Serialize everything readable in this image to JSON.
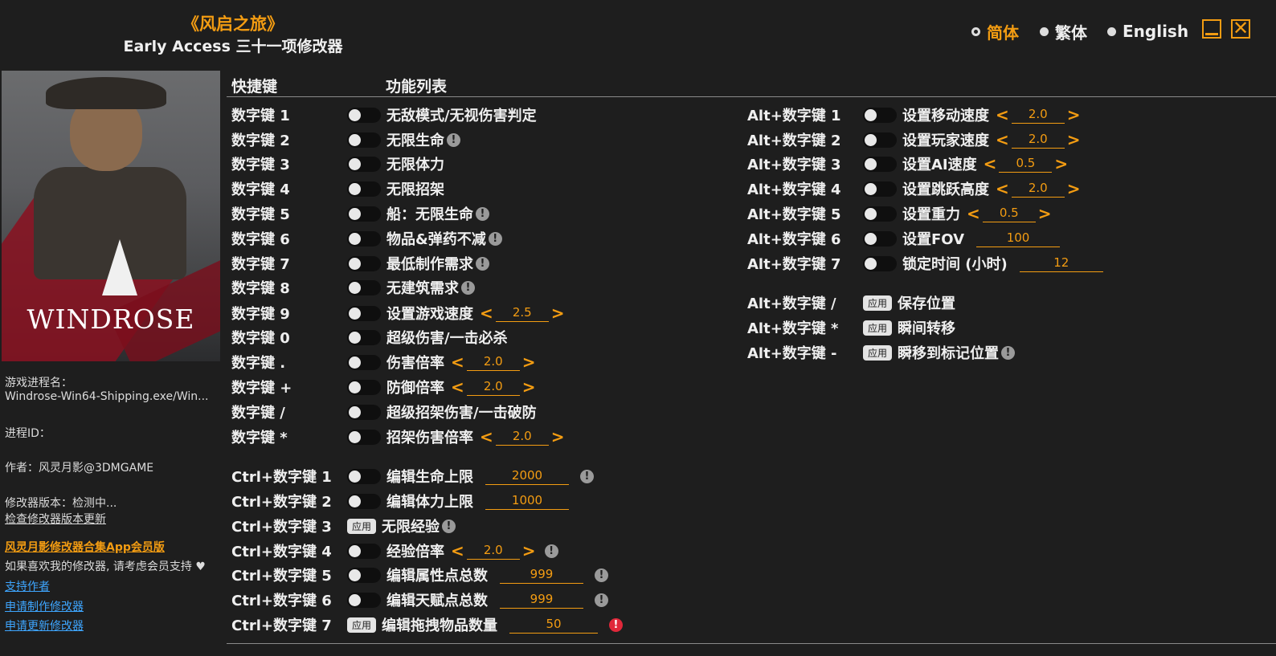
{
  "header": {
    "game_title": "《风启之旅》",
    "subtitle": "Early Access 三十一项修改器",
    "languages": [
      {
        "label": "简体",
        "selected": true
      },
      {
        "label": "繁体",
        "selected": false
      },
      {
        "label": "English",
        "selected": false
      }
    ],
    "minimize_icon": "minimize-icon",
    "close_icon": "close-icon",
    "close_glyph": "✕"
  },
  "colors": {
    "accent": "#f39c12",
    "link": "#3ea6ff",
    "warning": "#e0283a",
    "background": "#1e1e1e"
  },
  "sidebar": {
    "cover_logo": "WINDROSE",
    "process_name_label": "游戏进程名：",
    "process_name_value": "Windrose-Win64-Shipping.exe/Win...",
    "process_id_label": "进程ID：",
    "author": "作者：风灵月影@3DMGAME",
    "version": "修改器版本：检测中...",
    "check_update": "检查修改器版本更新",
    "app_member": "风灵月影修改器合集App会员版",
    "support_note": "如果喜欢我的修改器, 请考虑会员支持 ♥",
    "support_author": "支持作者",
    "request_make": "申请制作修改器",
    "request_update": "申请更新修改器"
  },
  "main": {
    "col_hotkey": "快捷键",
    "col_functions": "功能列表",
    "left_rows": [
      {
        "key": "数字键 1",
        "control": "toggle",
        "name": "无敌模式/无视伤害判定"
      },
      {
        "key": "数字键 2",
        "control": "toggle",
        "name": "无限生命",
        "info": "!"
      },
      {
        "key": "数字键 3",
        "control": "toggle",
        "name": "无限体力"
      },
      {
        "key": "数字键 4",
        "control": "toggle",
        "name": "无限招架"
      },
      {
        "key": "数字键 5",
        "control": "toggle",
        "name": "船：无限生命",
        "info": "!"
      },
      {
        "key": "数字键 6",
        "control": "toggle",
        "name": "物品&弹药不减",
        "info": "!"
      },
      {
        "key": "数字键 7",
        "control": "toggle",
        "name": "最低制作需求",
        "info": "!"
      },
      {
        "key": "数字键 8",
        "control": "toggle",
        "name": "无建筑需求",
        "info": "!"
      },
      {
        "key": "数字键 9",
        "control": "toggle",
        "name": "设置游戏速度",
        "value": "2.5",
        "arrows": true
      },
      {
        "key": "数字键 0",
        "control": "toggle",
        "name": "超级伤害/一击必杀"
      },
      {
        "key": "数字键 .",
        "control": "toggle",
        "name": "伤害倍率",
        "value": "2.0",
        "arrows": true
      },
      {
        "key": "数字键 +",
        "control": "toggle",
        "name": "防御倍率",
        "value": "2.0",
        "arrows": true
      },
      {
        "key": "数字键 /",
        "control": "toggle",
        "name": "超级招架伤害/一击破防"
      },
      {
        "key": "数字键 *",
        "control": "toggle",
        "name": "招架伤害倍率",
        "value": "2.0",
        "arrows": true
      },
      {
        "key": "Ctrl+数字键 1",
        "control": "toggle",
        "name": "编辑生命上限",
        "value": "2000",
        "info": "!"
      },
      {
        "key": "Ctrl+数字键 2",
        "control": "toggle",
        "name": "编辑体力上限",
        "value": "1000"
      },
      {
        "key": "Ctrl+数字键 3",
        "control": "apply",
        "name": "无限经验",
        "info": "!"
      },
      {
        "key": "Ctrl+数字键 4",
        "control": "toggle",
        "name": "经验倍率",
        "value": "2.0",
        "arrows": true,
        "info": "!"
      },
      {
        "key": "Ctrl+数字键 5",
        "control": "toggle",
        "name": "编辑属性点总数",
        "value": "999",
        "info": "!"
      },
      {
        "key": "Ctrl+数字键 6",
        "control": "toggle",
        "name": "编辑天赋点总数",
        "value": "999",
        "info": "!"
      },
      {
        "key": "Ctrl+数字键 7",
        "control": "apply",
        "name": "编辑拖拽物品数量",
        "value": "50",
        "info": "!",
        "info_red": true
      }
    ],
    "right_rows": [
      {
        "key": "Alt+数字键 1",
        "control": "toggle",
        "name": "设置移动速度",
        "value": "2.0",
        "arrows": true
      },
      {
        "key": "Alt+数字键 2",
        "control": "toggle",
        "name": "设置玩家速度",
        "value": "2.0",
        "arrows": true
      },
      {
        "key": "Alt+数字键 3",
        "control": "toggle",
        "name": "设置AI速度",
        "value": "0.5",
        "arrows": true
      },
      {
        "key": "Alt+数字键 4",
        "control": "toggle",
        "name": "设置跳跃高度",
        "value": "2.0",
        "arrows": true
      },
      {
        "key": "Alt+数字键 5",
        "control": "toggle",
        "name": "设置重力",
        "value": "0.5",
        "arrows": true
      },
      {
        "key": "Alt+数字键 6",
        "control": "toggle",
        "name": "设置FOV",
        "value": "100"
      },
      {
        "key": "Alt+数字键 7",
        "control": "toggle",
        "name": "锁定时间 (小时)",
        "value": "12"
      },
      {
        "key": "Alt+数字键 /",
        "control": "apply",
        "name": "保存位置"
      },
      {
        "key": "Alt+数字键 *",
        "control": "apply",
        "name": "瞬间转移"
      },
      {
        "key": "Alt+数字键 -",
        "control": "apply",
        "name": "瞬移到标记位置",
        "info": "!"
      }
    ],
    "apply_label": "应用",
    "arrow_left": "<",
    "arrow_right": ">"
  }
}
